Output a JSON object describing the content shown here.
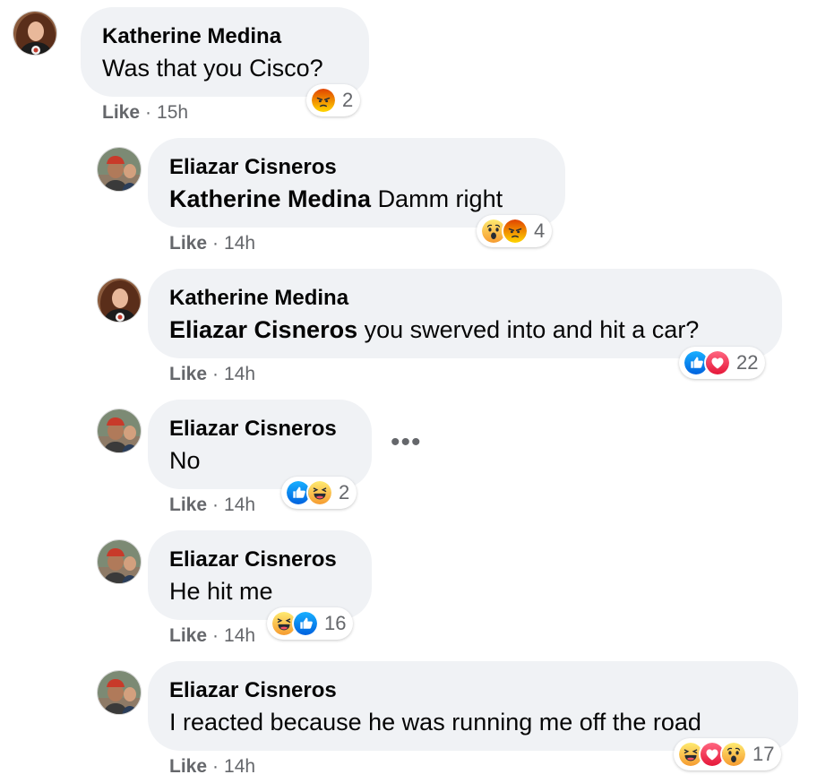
{
  "comments": [
    {
      "author": "Katherine Medina",
      "mention": "",
      "text": "Was that you Cisco?",
      "like": "Like",
      "dot": "·",
      "time": "15h",
      "reactions": [
        "angry"
      ],
      "reaction_count": "2"
    },
    {
      "author": "Eliazar Cisneros",
      "mention": "Katherine Medina",
      "text": "Damm right",
      "like": "Like",
      "dot": "·",
      "time": "14h",
      "reactions": [
        "wow",
        "angry"
      ],
      "reaction_count": "4"
    },
    {
      "author": "Katherine Medina",
      "mention": "Eliazar Cisneros",
      "text": "you swerved into and hit a car?",
      "like": "Like",
      "dot": "·",
      "time": "14h",
      "reactions": [
        "like",
        "love"
      ],
      "reaction_count": "22"
    },
    {
      "author": "Eliazar Cisneros",
      "mention": "",
      "text": "No",
      "like": "Like",
      "dot": "·",
      "time": "14h",
      "reactions": [
        "like",
        "haha"
      ],
      "reaction_count": "2"
    },
    {
      "author": "Eliazar Cisneros",
      "mention": "",
      "text": "He hit me",
      "like": "Like",
      "dot": "·",
      "time": "14h",
      "reactions": [
        "haha",
        "like"
      ],
      "reaction_count": "16"
    },
    {
      "author": "Eliazar Cisneros",
      "mention": "",
      "text": "I reacted because he was running me off the road",
      "like": "Like",
      "dot": "·",
      "time": "14h",
      "reactions": [
        "haha",
        "love",
        "wow"
      ],
      "reaction_count": "17"
    }
  ],
  "more_options": "•••",
  "colors": {
    "bubble": "#f0f2f5",
    "meta_text": "#65676b",
    "like_blue": "#1877f2",
    "love_red": "#f33e58",
    "emoji_yellow": "#f7b125",
    "angry_orange": "#e9710f"
  }
}
